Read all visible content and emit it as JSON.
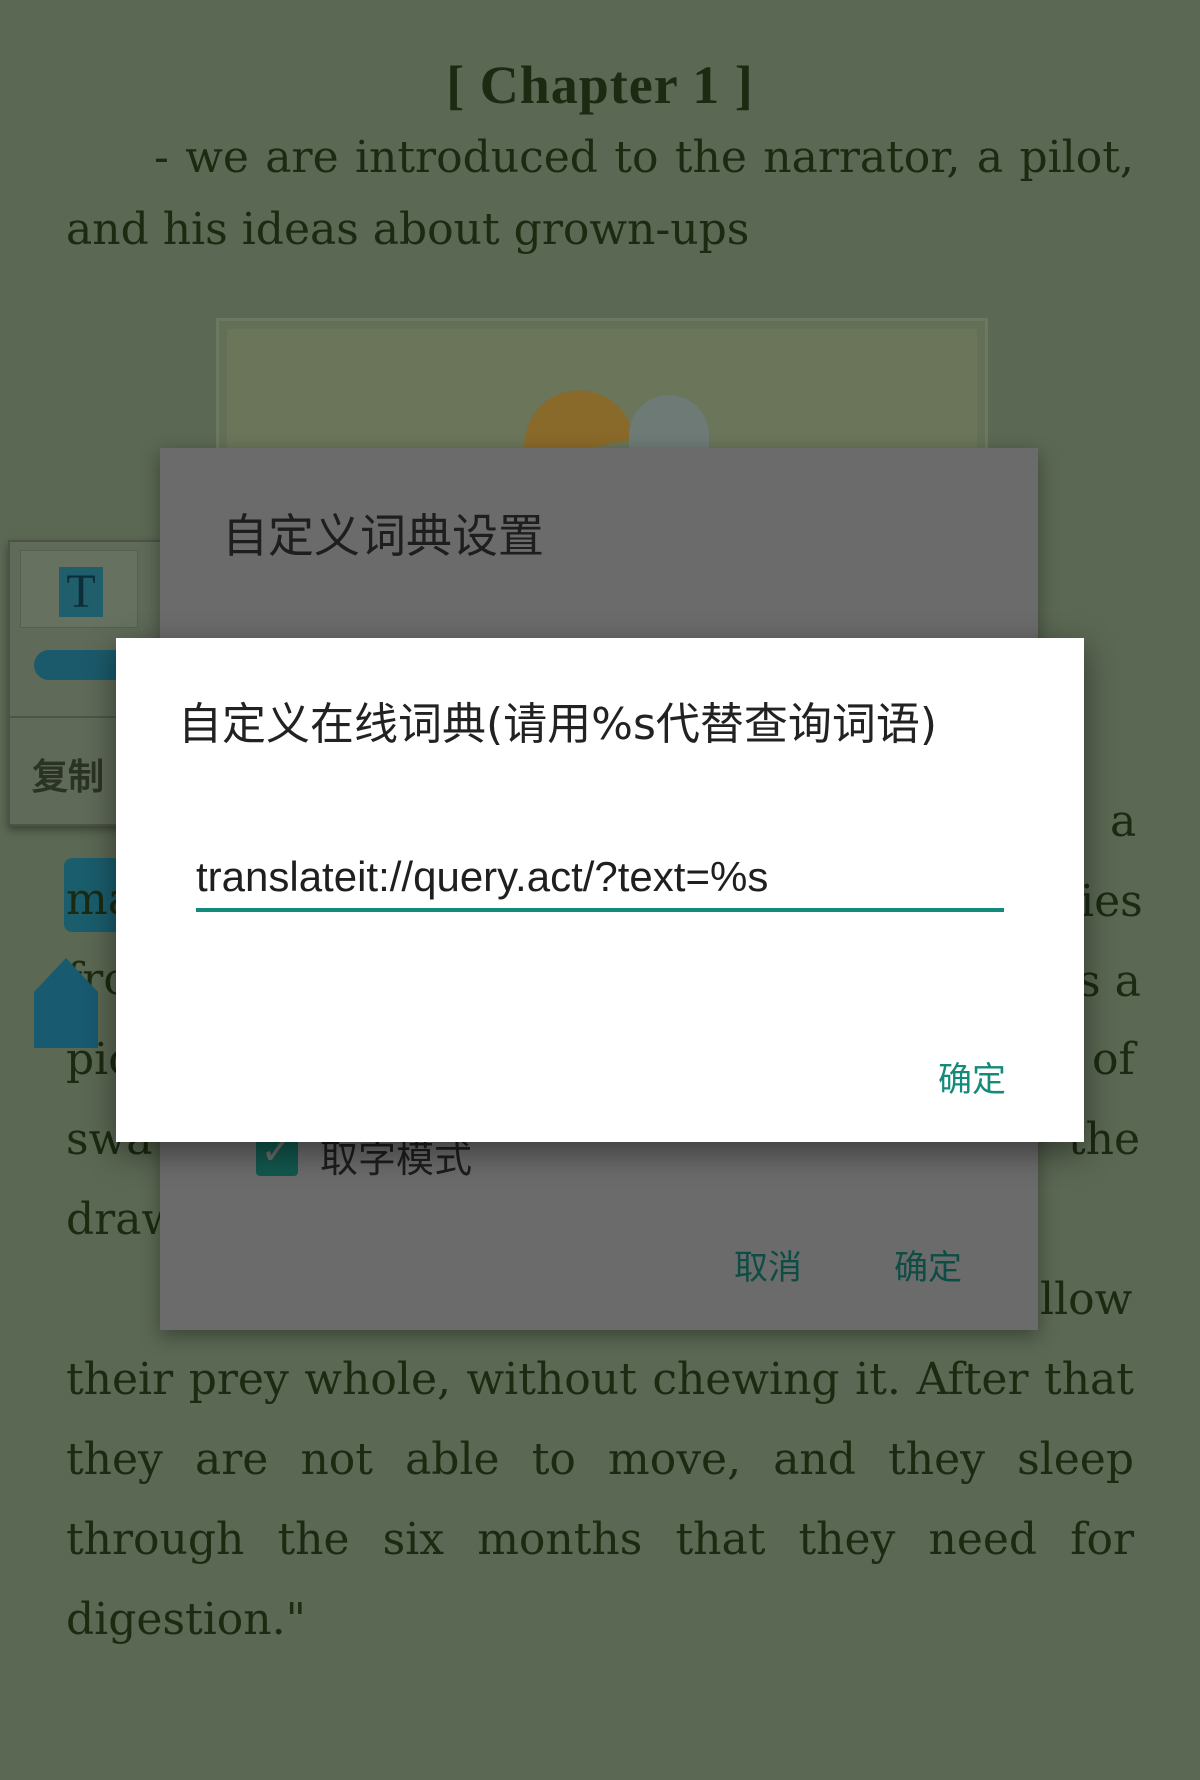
{
  "reader": {
    "chapter_title": "[ Chapter 1 ]",
    "para1_line1_words": [
      "-",
      "we",
      "are",
      "introduced",
      "to",
      "the",
      "narrator,",
      "a",
      "pilot,"
    ],
    "para1_line2": "and his ideas about grown-ups",
    "right_fragments": [
      "a",
      "ies",
      "s a",
      "of",
      "the",
      "llow"
    ],
    "left_fragments": [
      "ma",
      "fro",
      "pic",
      "swa",
      "draw"
    ],
    "para_line_a_words": [
      "their",
      "prey",
      "whole,",
      "without",
      "chewing",
      "it.",
      "After",
      "that"
    ],
    "para_line_b_words": [
      "they",
      "are",
      "not",
      "able",
      "to",
      "move,",
      "and",
      "they",
      "sleep"
    ],
    "para_line_c_words": [
      "through",
      "the",
      "six",
      "months",
      "that",
      "they",
      "need",
      "for"
    ],
    "para_line_d": "digestion.\""
  },
  "selection_popup": {
    "text_icon": "T",
    "copy_label": "复制"
  },
  "back_dialog": {
    "title": "自定义词典设置",
    "checkbox_label": "取字模式",
    "checkbox_checked": true,
    "cancel_label": "取消",
    "ok_label": "确定"
  },
  "front_dialog": {
    "title": "自定义在线词典(请用%s代替查询词语)",
    "url_value": "translateit://query.act/?text=%s",
    "ok_label": "确定"
  },
  "colors": {
    "accent": "#138a7a",
    "reader_bg": "#5b6853"
  }
}
